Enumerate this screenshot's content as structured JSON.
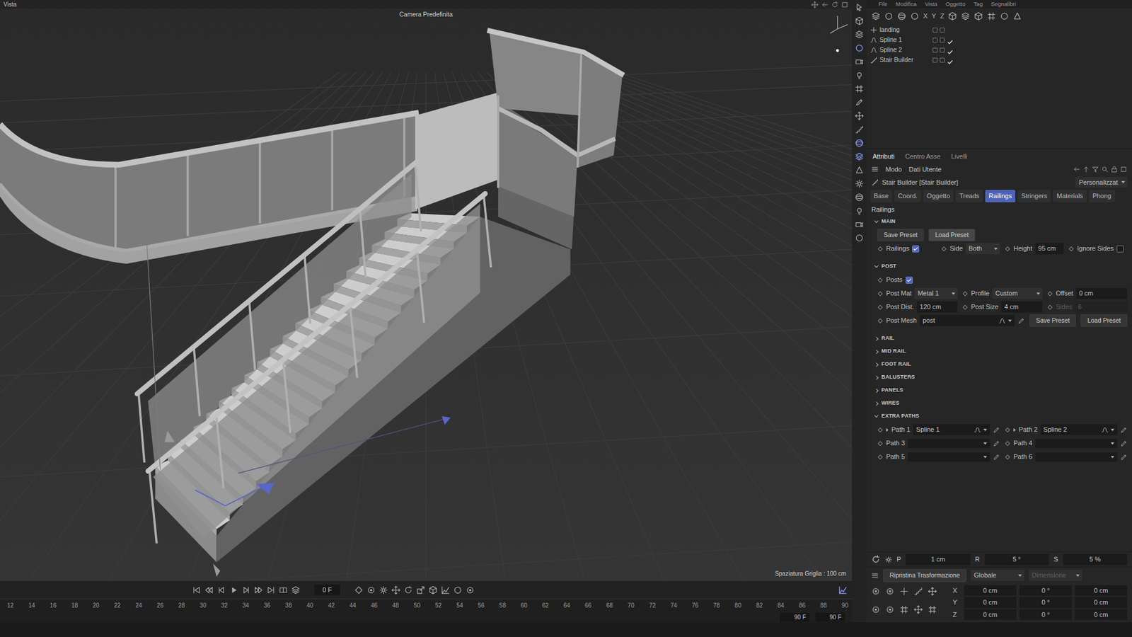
{
  "menu": [
    "File",
    "Modifica",
    "Vista",
    "Oggetto",
    "Tag",
    "Segnalibri"
  ],
  "viewport": {
    "menu": "Vista",
    "camera": "Camera Predefinita",
    "grid_spacing": "Spaziatura Griglia : 100 cm"
  },
  "timeline": {
    "frame": "0 F",
    "ticks": [
      "12",
      "14",
      "16",
      "18",
      "20",
      "22",
      "24",
      "26",
      "28",
      "30",
      "32",
      "34",
      "36",
      "38",
      "40",
      "42",
      "44",
      "46",
      "48",
      "50",
      "52",
      "54",
      "56",
      "58",
      "60",
      "62",
      "64",
      "66",
      "68",
      "70",
      "72",
      "74",
      "76",
      "78",
      "80",
      "82",
      "84",
      "86",
      "88",
      "90"
    ],
    "end_start": "90 F",
    "end_stop": "90 F"
  },
  "object_manager": {
    "axes": [
      "X",
      "Y",
      "Z"
    ],
    "objects": [
      {
        "name": "landing",
        "enabled": false
      },
      {
        "name": "Spline 1",
        "enabled": true
      },
      {
        "name": "Spline 2",
        "enabled": true
      },
      {
        "name": "Stair Builder",
        "enabled": true
      }
    ]
  },
  "attributes": {
    "tabs": [
      {
        "label": "Attributi",
        "selected": true
      },
      {
        "label": "Centro Asse",
        "selected": false
      },
      {
        "label": "Livelli",
        "selected": false
      }
    ],
    "menus": [
      "Modo",
      "Dati Utente"
    ],
    "object": "Stair Builder [Stair Builder]",
    "layout": "Personalizzat",
    "pages": [
      {
        "label": "Base",
        "selected": false
      },
      {
        "label": "Coord.",
        "selected": false
      },
      {
        "label": "Oggetto",
        "selected": false
      },
      {
        "label": "Treads",
        "selected": false
      },
      {
        "label": "Railings",
        "selected": true
      },
      {
        "label": "Stringers",
        "selected": false
      },
      {
        "label": "Materials",
        "selected": false
      },
      {
        "label": "Phong",
        "selected": false
      }
    ],
    "heading": "Railings",
    "sections": [
      {
        "title": "MAIN",
        "expanded": true,
        "rows": [
          [
            {
              "kind": "button",
              "label": "Save Preset"
            },
            {
              "kind": "button",
              "label": "Load Preset"
            }
          ],
          [
            {
              "kind": "check",
              "label": "Railings",
              "checked": true
            },
            {
              "kind": "select",
              "label": "Side",
              "value": "Both"
            },
            {
              "kind": "input",
              "label": "Height",
              "value": "95 cm",
              "disabled": false
            },
            {
              "kind": "check",
              "label": "Ignore Sides",
              "checked": false
            }
          ]
        ]
      },
      {
        "title": "POST",
        "expanded": true,
        "rows": [
          [
            {
              "kind": "check",
              "label": "Posts",
              "checked": true
            }
          ],
          [
            {
              "kind": "select",
              "label": "Post Mat",
              "value": "Metal 1"
            },
            {
              "kind": "select",
              "label": "Profile",
              "value": "Custom"
            },
            {
              "kind": "input",
              "label": "Offset",
              "value": "0 cm",
              "disabled": false
            }
          ],
          [
            {
              "kind": "input",
              "label": "Post Dist.",
              "value": "120 cm",
              "disabled": false
            },
            {
              "kind": "input",
              "label": "Post Size",
              "value": "4 cm",
              "disabled": false
            },
            {
              "kind": "input",
              "label": "Sides",
              "value": "6",
              "disabled": true
            }
          ],
          [
            {
              "kind": "link",
              "label": "Post Mesh",
              "value": "post",
              "expandable": false
            },
            {
              "kind": "button",
              "label": "Save Preset"
            },
            {
              "kind": "button",
              "label": "Load Preset"
            }
          ]
        ]
      },
      {
        "title": "RAIL",
        "expanded": false,
        "rows": []
      },
      {
        "title": "MID RAIL",
        "expanded": false,
        "rows": []
      },
      {
        "title": "FOOT RAIL",
        "expanded": false,
        "rows": []
      },
      {
        "title": "BALUSTERS",
        "expanded": false,
        "rows": []
      },
      {
        "title": "PANELS",
        "expanded": false,
        "rows": []
      },
      {
        "title": "WIRES",
        "expanded": false,
        "rows": []
      },
      {
        "title": "EXTRA PATHS",
        "expanded": true,
        "rows": [
          [
            {
              "kind": "link",
              "label": "Path 1",
              "value": "Spline 1",
              "expandable": true
            },
            {
              "kind": "link",
              "label": "Path 2",
              "value": "Spline 2",
              "expandable": true
            }
          ],
          [
            {
              "kind": "link",
              "label": "Path 3",
              "value": "",
              "expandable": false
            },
            {
              "kind": "link",
              "label": "Path 4",
              "value": "",
              "expandable": false
            }
          ],
          [
            {
              "kind": "link",
              "label": "Path 5",
              "value": "",
              "expandable": false
            },
            {
              "kind": "link",
              "label": "Path 6",
              "value": "",
              "expandable": false
            }
          ]
        ]
      }
    ]
  },
  "snap": {
    "p_label": "P",
    "p": "1 cm",
    "r_label": "R",
    "r": "5 °",
    "s_label": "S",
    "s": "5 %"
  },
  "coordinates": {
    "reset": "Ripristina Trasformazione",
    "space": "Globale",
    "mode": "Dimensione",
    "mode_disabled": true,
    "rows": [
      {
        "axis": "X",
        "pos": "0 cm",
        "rot": "0 °",
        "size": "0 cm"
      },
      {
        "axis": "Y",
        "pos": "0 cm",
        "rot": "0 °",
        "size": "0 cm"
      },
      {
        "axis": "Z",
        "pos": "0 cm",
        "rot": "0 °",
        "size": "0 cm"
      }
    ]
  }
}
